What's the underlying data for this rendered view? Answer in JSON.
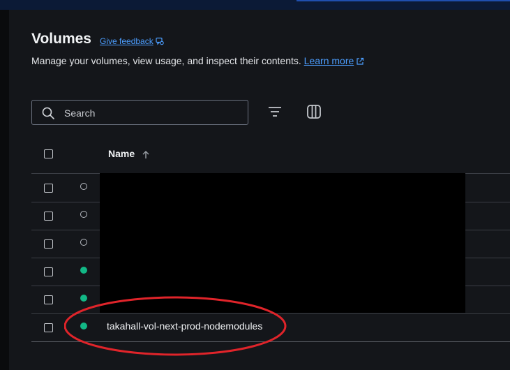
{
  "page": {
    "title": "Volumes",
    "feedback_label": "Give feedback",
    "description": "Manage your volumes, view usage, and inspect their contents.",
    "learn_more_label": "Learn more"
  },
  "toolbar": {
    "search_placeholder": "Search",
    "filter_icon": "filter-icon",
    "columns_icon": "columns-icon"
  },
  "table": {
    "columns": [
      {
        "label": "Name",
        "sort": "ascending"
      }
    ],
    "rows": [
      {
        "status": "unused",
        "name": ""
      },
      {
        "status": "unused",
        "name": ""
      },
      {
        "status": "unused",
        "name": ""
      },
      {
        "status": "in-use",
        "name": ""
      },
      {
        "status": "in-use",
        "name": ""
      },
      {
        "status": "in-use",
        "name": "takahall-vol-next-prod-nodemodules"
      }
    ]
  },
  "colors": {
    "accent_link": "#4c9eff",
    "status_in_use": "#12b886",
    "annotation": "#e0242a",
    "background": "#14161a"
  }
}
